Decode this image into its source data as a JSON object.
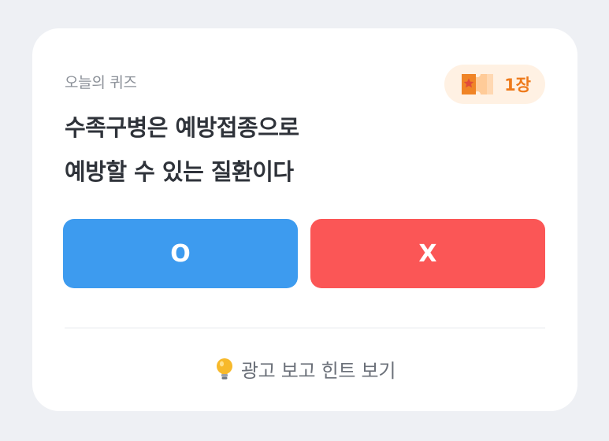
{
  "quiz": {
    "eyebrow": "오늘의 퀴즈",
    "badge_count": "1장",
    "badge_icon": "ticket-star-icon",
    "question_line1": "수족구병은 예방접종으로",
    "question_line2": "예방할 수 있는 질환이다",
    "answer_o": "O",
    "answer_x": "X",
    "hint_icon": "lightbulb-icon",
    "hint_label": "광고 보고 힌트 보기"
  },
  "colors": {
    "background": "#eef0f4",
    "card": "#ffffff",
    "answer_o": "#3d9bef",
    "answer_x": "#fb5656",
    "badge_bg": "#fff1e3",
    "badge_text": "#ee7a1b",
    "bulb": "#f7b92b"
  }
}
